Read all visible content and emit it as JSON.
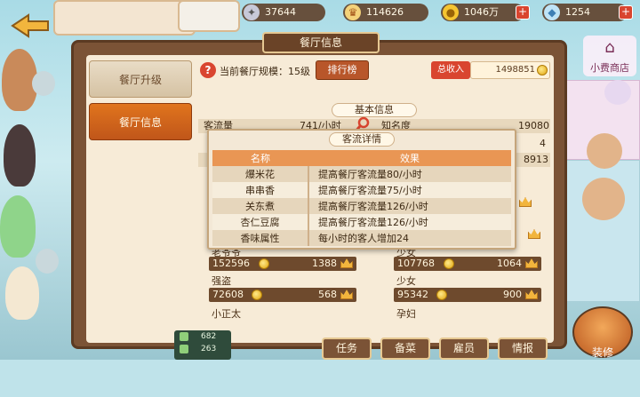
{
  "resources": {
    "gems": "37644",
    "crowns": "114626",
    "coins": "1046万",
    "crystals": "1254",
    "plus": "+"
  },
  "panel": {
    "title": "餐厅信息"
  },
  "sidebar": {
    "upgrade_label": "餐厅升级",
    "info_label": "餐厅信息"
  },
  "scale": {
    "label": "当前餐厅规模：15级",
    "rank_button": "排行榜",
    "income_label": "总收入",
    "income_value": "1498851"
  },
  "basic_info": {
    "title": "基本信息",
    "traffic_label": "客流量",
    "traffic_value": "741/小时",
    "fame_label": "知名度",
    "fame_value": "19080",
    "value_4": "4",
    "value_8913": "8913"
  },
  "popup": {
    "title": "客流详情",
    "col_name": "名称",
    "col_effect": "效果",
    "rows": [
      {
        "name": "爆米花",
        "effect": "提高餐厅客流量80/小时"
      },
      {
        "name": "串串香",
        "effect": "提高餐厅客流量75/小时"
      },
      {
        "name": "关东煮",
        "effect": "提高餐厅客流量126/小时"
      },
      {
        "name": "杏仁豆腐",
        "effect": "提高餐厅客流量126/小时"
      },
      {
        "name": "香味属性",
        "effect": "每小时的客人增加24"
      }
    ]
  },
  "guests": {
    "old_grandpa_label": "老爷爷",
    "girl_label": "少女",
    "robber_label": "强盗",
    "young_man_label": "少女",
    "little_boy_label": "小正太",
    "pregnant_label": "孕妇",
    "row1_left_coins": "152596",
    "row1_left_crowns": "1388",
    "row1_right_coins": "107768",
    "row1_right_crowns": "1064",
    "row2_left_coins": "72608",
    "row2_left_crowns": "568",
    "row2_right_coins": "95342",
    "row2_right_crowns": "900"
  },
  "bottom_nav": {
    "task": "任务",
    "menu": "备菜",
    "staff": "雇员",
    "info": "情报",
    "decorate": "装修"
  },
  "shop": {
    "label": "小费商店"
  },
  "left_stats": {
    "a": "682",
    "b": "263"
  }
}
